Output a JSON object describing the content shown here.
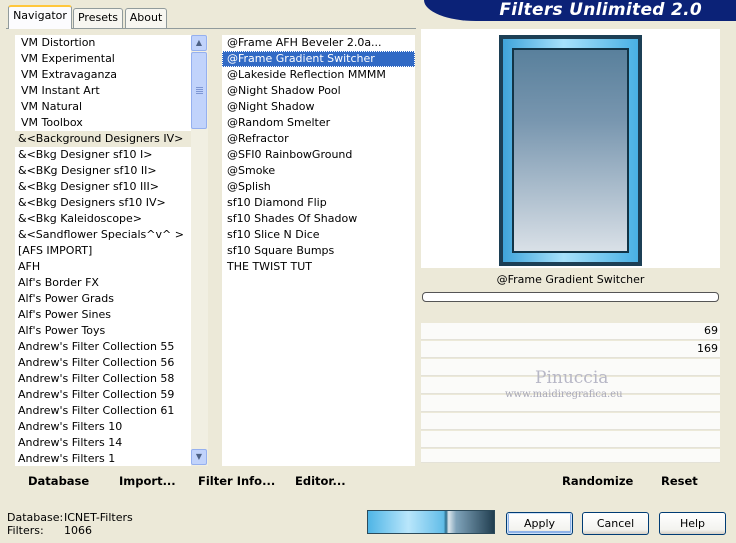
{
  "tabs": [
    {
      "label": "Navigator",
      "active": true
    },
    {
      "label": "Presets",
      "active": false
    },
    {
      "label": "About",
      "active": false
    }
  ],
  "banner_title": "Filters Unlimited 2.0",
  "categories": [
    "VM Distortion",
    "VM Experimental",
    "VM Extravaganza",
    "VM Instant Art",
    "VM Natural",
    "VM Toolbox",
    "&<Background Designers IV>",
    "&<Bkg Designer sf10 I>",
    "&<BKg Designer sf10 II>",
    "&<Bkg Designer sf10 III>",
    "&<Bkg Designers sf10 IV>",
    "&<Bkg Kaleidoscope>",
    "&<Sandflower Specials^v^ >",
    "[AFS IMPORT]",
    "AFH",
    "Alf's Border FX",
    "Alf's Power Grads",
    "Alf's Power Sines",
    "Alf's Power Toys",
    "Andrew's Filter Collection 55",
    "Andrew's Filter Collection 56",
    "Andrew's Filter Collection 58",
    "Andrew's Filter Collection 59",
    "Andrew's Filter Collection 61",
    "Andrew's Filters 10",
    "Andrew's Filters 14",
    "Andrew's Filters 1"
  ],
  "selected_category_index": 6,
  "filters": [
    "@Frame AFH Beveler 2.0a...",
    "@Frame Gradient Switcher",
    "@Lakeside Reflection MMMM",
    "@Night Shadow Pool",
    "@Night Shadow",
    "@Random Smelter",
    "@Refractor",
    "@SFI0 RainbowGround",
    "@Smoke",
    "@Splish",
    "sf10 Diamond Flip",
    "sf10 Shades Of Shadow",
    "sf10 Slice N Dice",
    "sf10 Square Bumps",
    "THE TWIST TUT"
  ],
  "selected_filter_index": 1,
  "preview_filter_name": "@Frame Gradient Switcher",
  "params": [
    "69",
    "169"
  ],
  "watermark": {
    "line1": "Pinuccia",
    "line2": "www.maidiregrafica.eu"
  },
  "actions": {
    "database": "Database",
    "import": "Import...",
    "filter_info": "Filter Info...",
    "editor": "Editor...",
    "randomize": "Randomize",
    "reset": "Reset"
  },
  "status": {
    "database_label": "Database:",
    "database_value": "ICNET-Filters",
    "filters_label": "Filters:",
    "filters_value": "1066"
  },
  "buttons": {
    "apply": "Apply",
    "cancel": "Cancel",
    "help": "Help"
  },
  "colors": {
    "banner": "#0b2277",
    "selection": "#316ac5",
    "tab_highlight": "#ffc73c"
  },
  "icons": {
    "scroll_up": "▲",
    "scroll_down": "▼"
  }
}
